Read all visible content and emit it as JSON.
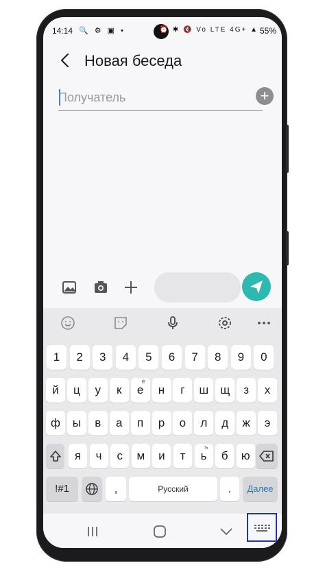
{
  "status_bar": {
    "time": "14:14",
    "left_icons": "🔍 ⚙ ▣ •",
    "right_icons": "⏰ ✱ 🔇 Vo LTE 4G+ ▲",
    "battery": "55%"
  },
  "header": {
    "back_icon": "chevron-left",
    "title": "Новая беседа"
  },
  "recipient": {
    "placeholder": "Получатель",
    "value": ""
  },
  "compose": {
    "message_placeholder": ""
  },
  "keyboard": {
    "toolbar": [
      "emoji-icon",
      "sticker-icon",
      "mic-icon",
      "settings-icon",
      "more-icon"
    ],
    "rows": [
      [
        {
          "k": "1"
        },
        {
          "k": "2"
        },
        {
          "k": "3"
        },
        {
          "k": "4"
        },
        {
          "k": "5"
        },
        {
          "k": "6"
        },
        {
          "k": "7"
        },
        {
          "k": "8"
        },
        {
          "k": "9"
        },
        {
          "k": "0"
        }
      ],
      [
        {
          "k": "й"
        },
        {
          "k": "ц"
        },
        {
          "k": "у"
        },
        {
          "k": "к"
        },
        {
          "k": "е",
          "h": "ё"
        },
        {
          "k": "н"
        },
        {
          "k": "г"
        },
        {
          "k": "ш"
        },
        {
          "k": "щ"
        },
        {
          "k": "з"
        },
        {
          "k": "х"
        }
      ],
      [
        {
          "k": "ф"
        },
        {
          "k": "ы"
        },
        {
          "k": "в"
        },
        {
          "k": "а"
        },
        {
          "k": "п"
        },
        {
          "k": "р"
        },
        {
          "k": "о"
        },
        {
          "k": "л"
        },
        {
          "k": "д"
        },
        {
          "k": "ж"
        },
        {
          "k": "э"
        }
      ],
      [
        {
          "k": "я"
        },
        {
          "k": "ч"
        },
        {
          "k": "с"
        },
        {
          "k": "м"
        },
        {
          "k": "и"
        },
        {
          "k": "т"
        },
        {
          "k": "ь",
          "h": "ъ"
        },
        {
          "k": "б"
        },
        {
          "k": "ю"
        }
      ]
    ],
    "bottom": {
      "symbols": "!#1",
      "comma": ",",
      "space": "Русский",
      "period": ".",
      "enter": "Далее"
    }
  },
  "navbar": [
    "recent-apps-icon",
    "home-icon",
    "back-icon",
    "keyboard-icon"
  ]
}
